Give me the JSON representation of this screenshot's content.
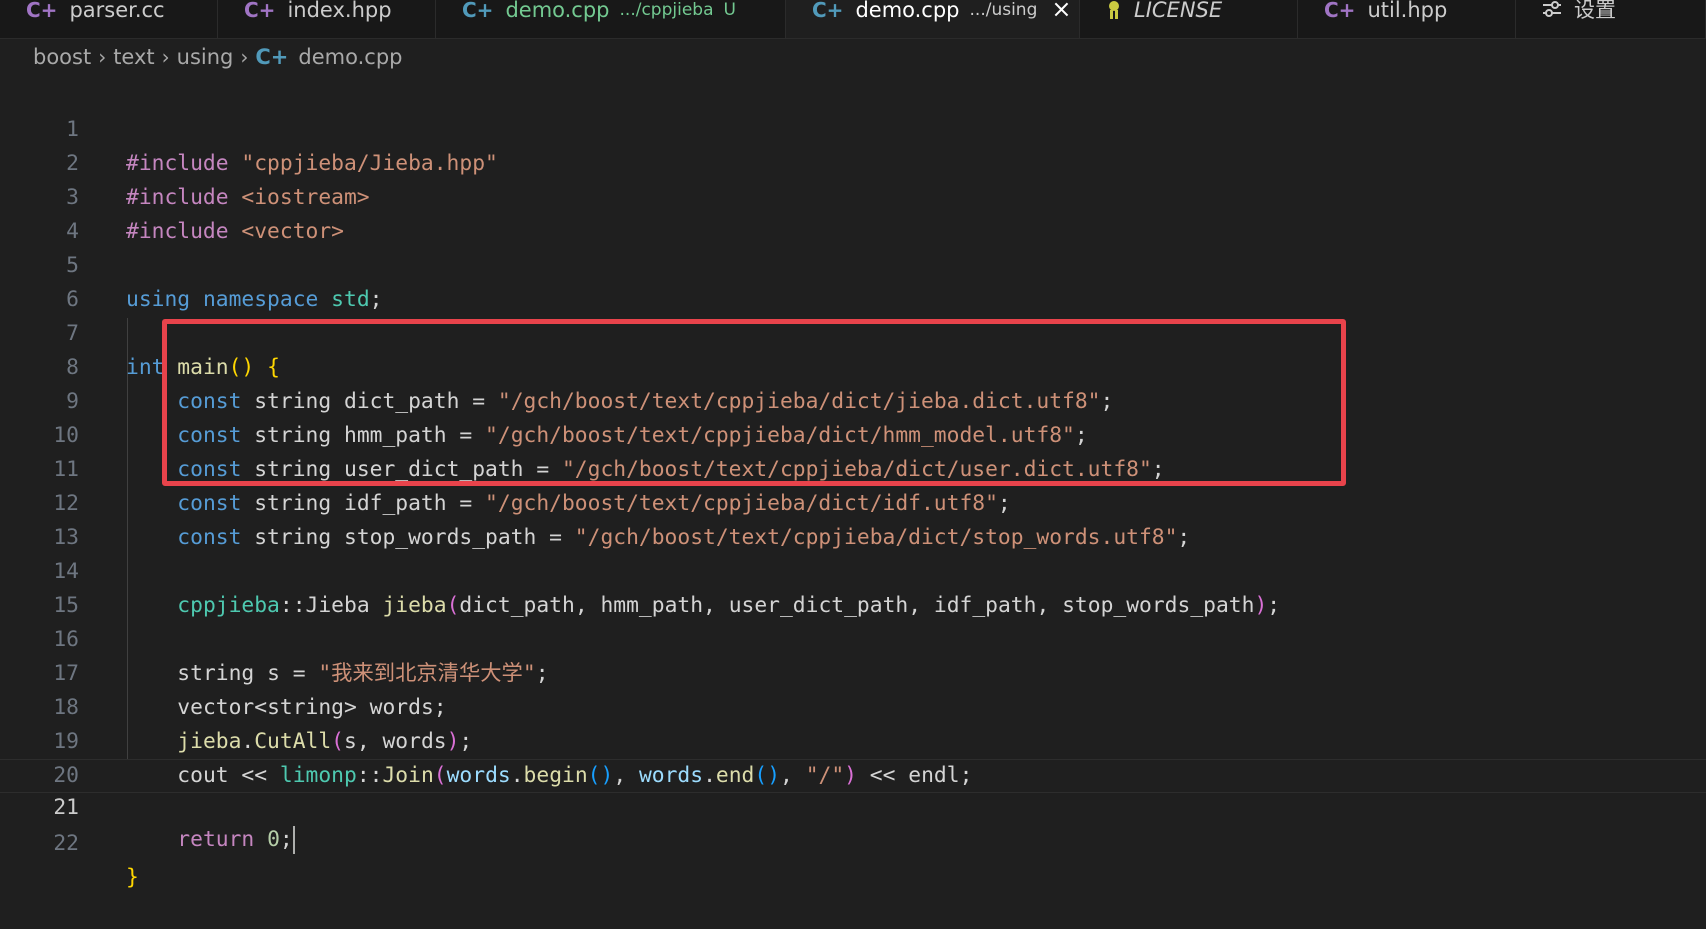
{
  "tabs": [
    {
      "icon": "C+",
      "label": "parser.cc"
    },
    {
      "icon": "C+",
      "label": "index.hpp"
    },
    {
      "icon": "C+",
      "label": "demo.cpp",
      "description": ".../cppjieba",
      "git_status": "U"
    },
    {
      "icon": "C+",
      "label": "demo.cpp",
      "description": ".../using",
      "close": "×"
    },
    {
      "icon": "license-icon",
      "label": "LICENSE"
    },
    {
      "icon": "C+",
      "label": "util.hpp"
    },
    {
      "icon": "settings-icon",
      "label": "设置"
    }
  ],
  "breadcrumb": {
    "items": [
      "boost",
      "text",
      "using"
    ],
    "file_icon": "C+",
    "file": "demo.cpp"
  },
  "editor": {
    "current_line": 21,
    "line_numbers": [
      "1",
      "2",
      "3",
      "4",
      "5",
      "6",
      "7",
      "8",
      "9",
      "10",
      "11",
      "12",
      "13",
      "14",
      "15",
      "16",
      "17",
      "18",
      "19",
      "20",
      "21",
      "22"
    ],
    "lines": [
      "#include \"cppjieba/Jieba.hpp\"",
      "#include <iostream>",
      "#include <vector>",
      "",
      "using namespace std;",
      "",
      "int main() {",
      "    const string dict_path = \"/gch/boost/text/cppjieba/dict/jieba.dict.utf8\";",
      "    const string hmm_path = \"/gch/boost/text/cppjieba/dict/hmm_model.utf8\";",
      "    const string user_dict_path = \"/gch/boost/text/cppjieba/dict/user.dict.utf8\";",
      "    const string idf_path = \"/gch/boost/text/cppjieba/dict/idf.utf8\";",
      "    const string stop_words_path = \"/gch/boost/text/cppjieba/dict/stop_words.utf8\";",
      "",
      "    cppjieba::Jieba jieba(dict_path, hmm_path, user_dict_path, idf_path, stop_words_path);",
      "",
      "    string s = \"我来到北京清华大学\";",
      "    vector<string> words;",
      "    jieba.CutAll(s, words);",
      "    cout << limonp::Join(words.begin(), words.end(), \"/\") << endl;",
      "",
      "    return 0;",
      "}"
    ]
  },
  "colors": {
    "background": "#1f1f1f",
    "keyword": "#569cd6",
    "preprocessor": "#c586c0",
    "string": "#ce9178",
    "function": "#dcdcaa",
    "namespace": "#4ec9b0",
    "variable": "#9cdcfe",
    "number": "#b5cea8",
    "highlight_box": "#e8434b"
  }
}
